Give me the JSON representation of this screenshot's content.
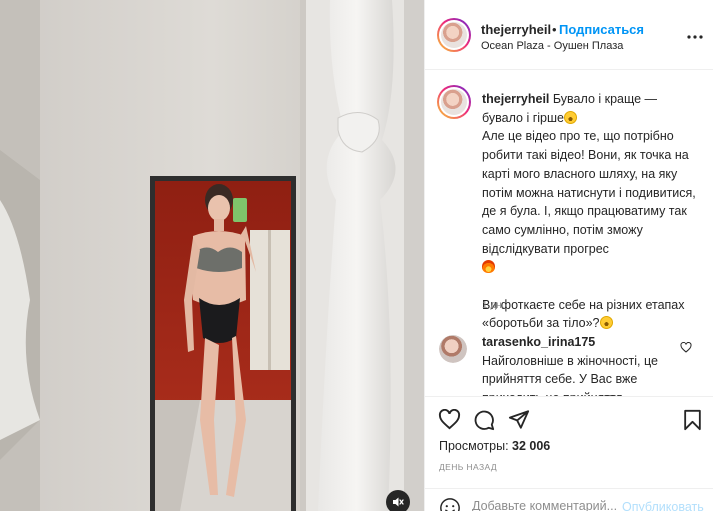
{
  "post": {
    "username": "thejerryheil",
    "follow_label": "Подписаться",
    "separator": "•",
    "location": "Ocean Plaza - Оушен Плаза",
    "more_icon": "more-horizontal-icon",
    "media_sound_icon": "speaker-muted-icon"
  },
  "caption": {
    "username": "thejerryheil",
    "line1": "Бувало і краще —",
    "line2": "бувало і гірше",
    "paragraph": "Але це відео про те, що потрібно робити такі відео! Вони, як точка на карті мого власного шляху, на яку потім можна натиснути і подивитися, де я була. І, якщо працюватиму так само сумлінно, потім зможу відслідкувати прогрес",
    "question": "Ви фоткаєте себе на різних етапах «боротьби за тіло»?",
    "time": "1 дн."
  },
  "comment": {
    "username": "tarasenko_irina175",
    "text": "Найголовніше в жіночності, це прийняття себе. У Вас вже приходить це прийняття,"
  },
  "actions": {
    "icons": [
      "heart-icon",
      "comment-icon",
      "share-icon",
      "bookmark-icon"
    ],
    "views_label": "Просмотры:",
    "views_count": "32 006",
    "date": "ДЕНЬ НАЗАД"
  },
  "add_comment": {
    "placeholder": "Добавьте комментарий...",
    "publish_label": "Опубликовать"
  },
  "colors": {
    "accent": "#0095f6",
    "publish_disabled": "#b2dffc",
    "muted": "#8e8e8e"
  }
}
